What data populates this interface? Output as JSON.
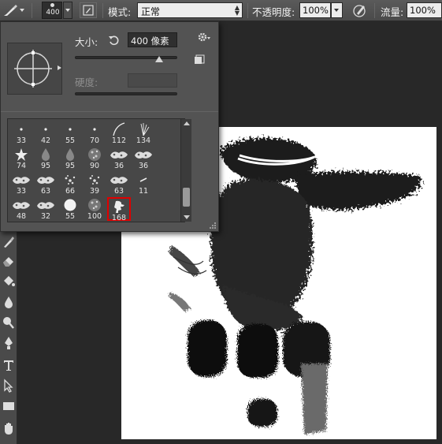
{
  "options_bar": {
    "brush_size": "400",
    "mode_label": "模式:",
    "mode_value": "正常",
    "opacity_label": "不透明度:",
    "opacity_value": "100%",
    "flow_label": "流量:",
    "flow_value": "100%"
  },
  "brush_popup": {
    "size_label": "大小:",
    "size_value": "400 像素",
    "size_fraction": 0.82,
    "hardness_label": "硬度:"
  },
  "brush_presets": [
    {
      "size": "33",
      "shape": "soft-dot-small"
    },
    {
      "size": "42",
      "shape": "soft-dot-small"
    },
    {
      "size": "55",
      "shape": "soft-dot-small"
    },
    {
      "size": "70",
      "shape": "soft-dot-small"
    },
    {
      "size": "112",
      "shape": "curve-stroke"
    },
    {
      "size": "134",
      "shape": "grass"
    },
    {
      "size": "74",
      "shape": "star-leaf"
    },
    {
      "size": "95",
      "shape": "drop"
    },
    {
      "size": "95",
      "shape": "drop"
    },
    {
      "size": "90",
      "shape": "texture-ball"
    },
    {
      "size": "36",
      "shape": "chalk"
    },
    {
      "size": "36",
      "shape": "chalk"
    },
    {
      "size": "33",
      "shape": "chalk"
    },
    {
      "size": "63",
      "shape": "chalk"
    },
    {
      "size": "66",
      "shape": "spatter"
    },
    {
      "size": "39",
      "shape": "spatter"
    },
    {
      "size": "63",
      "shape": "chalk"
    },
    {
      "size": "11",
      "shape": "dash"
    },
    {
      "size": "48",
      "shape": "chalk"
    },
    {
      "size": "32",
      "shape": "chalk"
    },
    {
      "size": "55",
      "shape": "hard-round"
    },
    {
      "size": "100",
      "shape": "texture-ball"
    },
    {
      "size": "168",
      "shape": "custom-figure"
    }
  ],
  "selected_preset_index": 22,
  "colors": {
    "selection_outline": "#e00000",
    "panel_bg": "#535353",
    "workspace_bg": "#282828",
    "canvas_bg": "#ffffff"
  }
}
